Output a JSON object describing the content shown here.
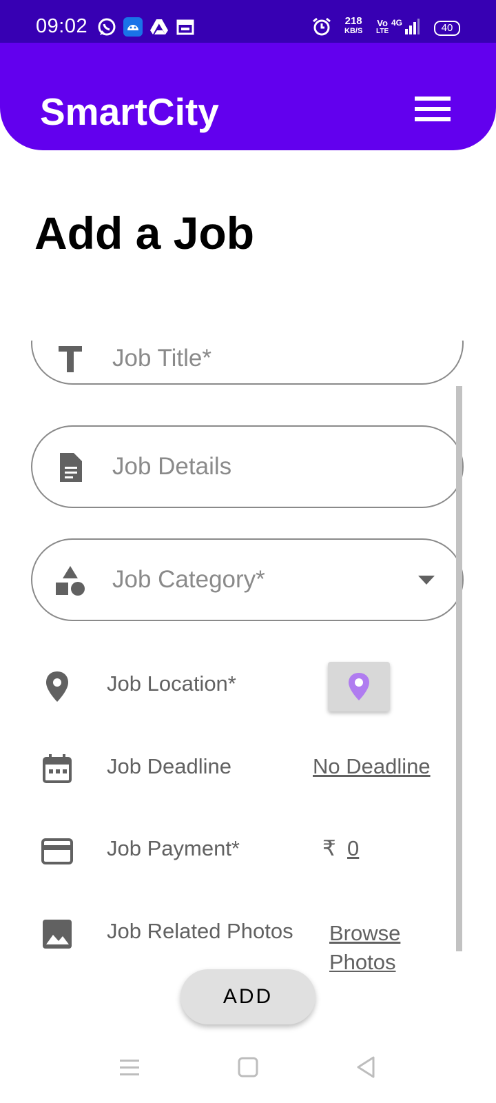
{
  "status_bar": {
    "time": "09:02",
    "net_speed_value": "218",
    "net_speed_unit": "KB/S",
    "volte_top": "Vo",
    "volte_bottom": "LTE",
    "network": "4G",
    "battery": "40",
    "icons": [
      "whatsapp-icon",
      "android-icon",
      "drive-icon",
      "calendar-icon",
      "alarm-icon",
      "signal-icon"
    ]
  },
  "app_bar": {
    "title": "SmartCity",
    "menu_icon": "hamburger-menu-icon"
  },
  "page": {
    "title": "Add a Job"
  },
  "form": {
    "job_title_placeholder": "Job Title*",
    "job_details_placeholder": "Job Details",
    "job_category_placeholder": "Job Category*",
    "location_label": "Job Location*",
    "deadline_label": "Job Deadline",
    "deadline_value": "No Deadline",
    "payment_label": "Job Payment*",
    "currency_symbol": "₹",
    "payment_value": "0",
    "photos_label": "Job Related Photos",
    "photos_link": "Browse Photos"
  },
  "actions": {
    "add_label": "ADD"
  },
  "colors": {
    "status_bar": "#3700b3",
    "app_bar": "#6200ee",
    "accent_pin": "#b07cf0",
    "gray": "#616161"
  }
}
